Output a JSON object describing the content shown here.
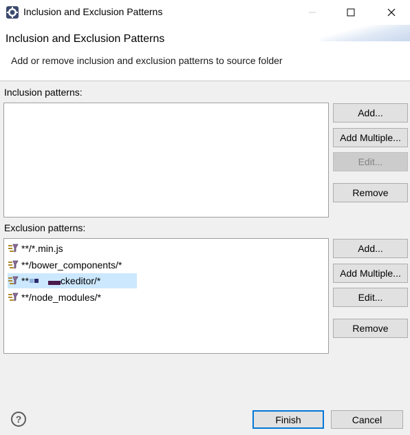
{
  "window": {
    "title": "Inclusion and Exclusion Patterns",
    "app_icon": "eclipse-gear-icon",
    "controls": {
      "minimize": "—",
      "maximize": "☐",
      "close": "✕"
    }
  },
  "banner": {
    "title": "Inclusion and Exclusion Patterns",
    "description": "Add or remove inclusion and exclusion patterns to source folder"
  },
  "inclusion": {
    "label": "Inclusion patterns:",
    "items": [],
    "buttons": {
      "add": "Add...",
      "add_multiple": "Add Multiple...",
      "edit": "Edit...",
      "remove": "Remove"
    }
  },
  "exclusion": {
    "label": "Exclusion patterns:",
    "items": [
      {
        "prefix": "**/*.min.js",
        "suffix": ""
      },
      {
        "prefix": "**/bower_components/*",
        "suffix": ""
      },
      {
        "prefix": "**",
        "suffix": "ckeditor/*",
        "selected": true
      },
      {
        "prefix": "**/node_modules/*",
        "suffix": ""
      }
    ],
    "item_icon": "exclusion-filter-icon",
    "buttons": {
      "add": "Add...",
      "add_multiple": "Add Multiple...",
      "edit": "Edit...",
      "remove": "Remove"
    }
  },
  "footer": {
    "help_icon": "help-icon",
    "help_glyph": "?",
    "finish": "Finish",
    "cancel": "Cancel"
  }
}
